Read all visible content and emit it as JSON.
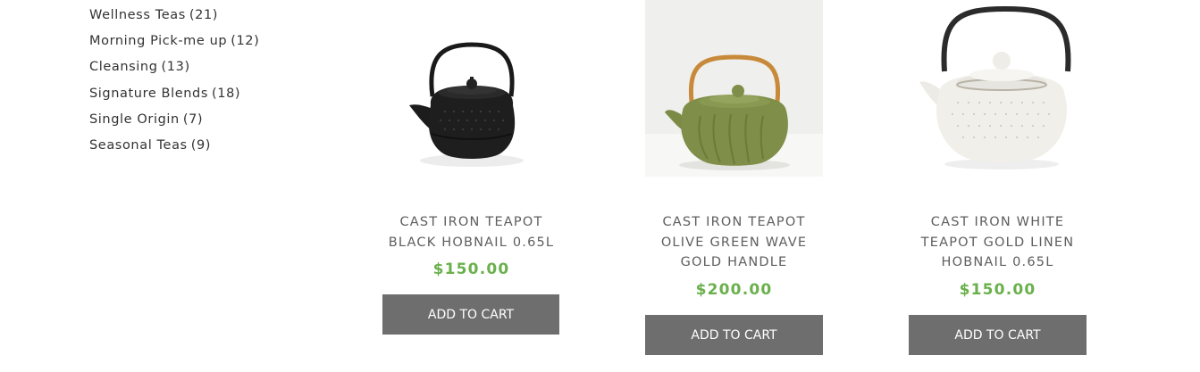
{
  "categories": [
    {
      "name": "Wellness Teas",
      "count": "(21)"
    },
    {
      "name": "Morning Pick-me up",
      "count": "(12)"
    },
    {
      "name": "Cleansing",
      "count": "(13)"
    },
    {
      "name": "Signature Blends",
      "count": "(18)"
    },
    {
      "name": "Single Origin",
      "count": "(7)"
    },
    {
      "name": "Seasonal Teas",
      "count": "(9)"
    }
  ],
  "products": [
    {
      "title_lines": [
        "CAST IRON TEAPOT",
        "BLACK HOBNAIL 0.65L"
      ],
      "price": "$150.00",
      "button": "ADD TO CART",
      "image": "black-cast-iron-teapot-image"
    },
    {
      "title_lines": [
        "CAST IRON TEAPOT",
        "OLIVE GREEN WAVE",
        "GOLD HANDLE"
      ],
      "price": "$200.00",
      "button": "ADD TO CART",
      "image": "olive-green-cast-iron-teapot-image"
    },
    {
      "title_lines": [
        "CAST IRON WHITE",
        "TEAPOT GOLD LINEN",
        "HOBNAIL 0.65L"
      ],
      "price": "$150.00",
      "button": "ADD TO CART",
      "image": "white-cast-iron-teapot-image"
    }
  ],
  "colors": {
    "price": "#6ab04c",
    "button_bg": "#6e6e6e",
    "title": "#5e5e5e",
    "category_text": "#333333"
  }
}
